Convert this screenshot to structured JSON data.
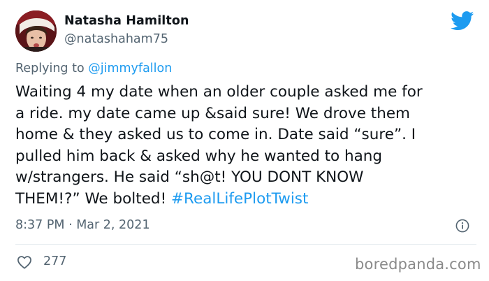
{
  "author": {
    "name": "Natasha Hamilton",
    "handle": "@natashaham75",
    "avatar_icon": "profile-photo"
  },
  "platform_icon": "twitter-bird-icon",
  "reply": {
    "prefix": "Replying to ",
    "mention": "@jimmyfallon"
  },
  "tweet": {
    "lines": [
      "Waiting 4 my date when an older couple asked me for",
      "a ride. my date came up &said sure! We drove them",
      "home & they asked us to come in. Date said “sure”. I",
      "pulled him back & asked why he wanted to hang",
      "w/strangers. He said “sh@t! YOU DONT KNOW",
      "THEM!?” We bolted! "
    ],
    "hashtag": "#RealLifePlotTwist"
  },
  "timestamp": "8:37 PM · Mar 2, 2021",
  "likes": "277",
  "watermark": "boredpanda.com",
  "colors": {
    "accent": "#1d9bf0",
    "secondary_text": "#536471",
    "primary_text": "#0f1419"
  }
}
